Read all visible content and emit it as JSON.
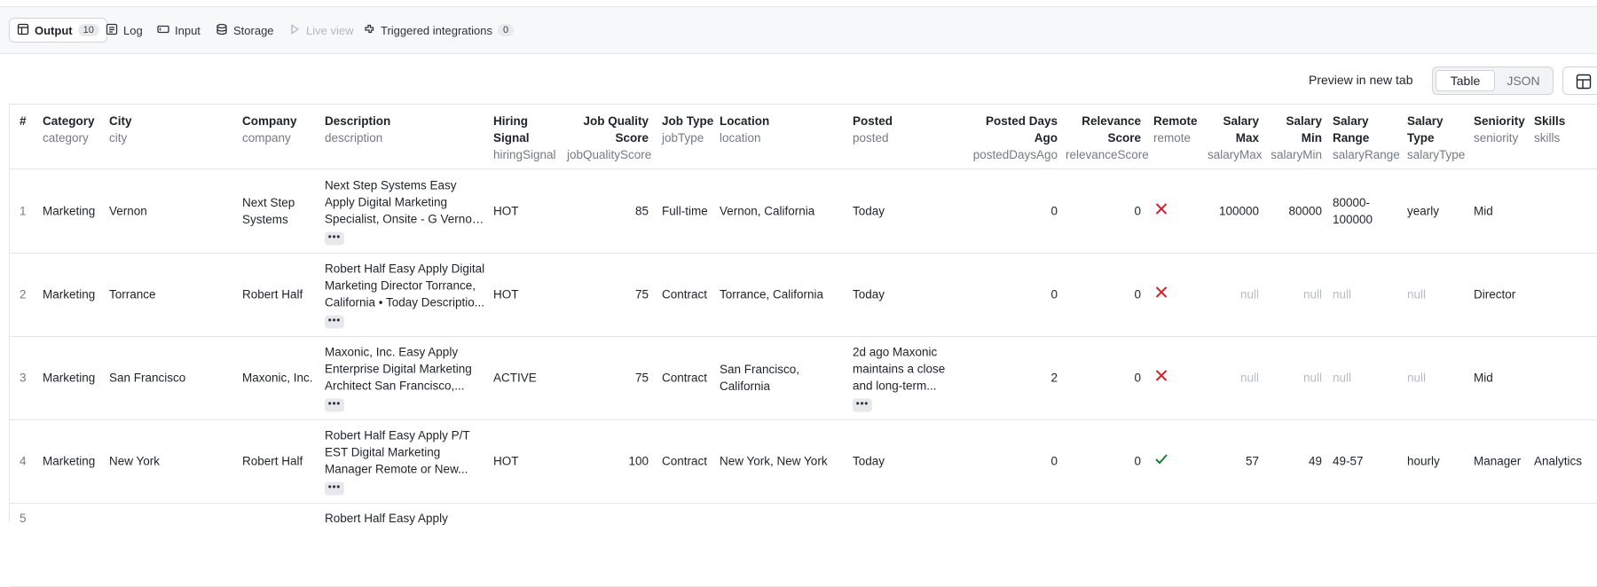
{
  "tabs": [
    {
      "label": "Output",
      "badge": "10",
      "icon": "table-icon",
      "state": "active"
    },
    {
      "label": "Log",
      "icon": "log-icon",
      "state": "normal"
    },
    {
      "label": "Input",
      "icon": "input-icon",
      "state": "normal"
    },
    {
      "label": "Storage",
      "icon": "database-icon",
      "state": "normal"
    },
    {
      "label": "Live view",
      "icon": "play-icon",
      "state": "disabled"
    },
    {
      "label": "Triggered integrations",
      "badge": "0",
      "icon": "integrations-icon",
      "state": "normal"
    }
  ],
  "toolbar": {
    "preview_label": "Preview in new tab",
    "view_table": "Table",
    "view_json": "JSON",
    "active_view": "Table",
    "layout_icon": "layout-icon"
  },
  "colors": {
    "remote_no": "#d1242f",
    "remote_yes": "#1a7f37",
    "null_text": "#b6bbc2"
  },
  "columns": [
    {
      "label": "#",
      "key": ""
    },
    {
      "label": "Category",
      "key": "category"
    },
    {
      "label": "City",
      "key": "city"
    },
    {
      "label": "Company",
      "key": "company"
    },
    {
      "label": "Description",
      "key": "description"
    },
    {
      "label": "Hiring Signal",
      "key": "hiringSignal"
    },
    {
      "label": "Job Quality Score",
      "key": "jobQualityScore"
    },
    {
      "label": "Job Type",
      "key": "jobType"
    },
    {
      "label": "Location",
      "key": "location"
    },
    {
      "label": "Posted",
      "key": "posted"
    },
    {
      "label": "Posted Days Ago",
      "key": "postedDaysAgo"
    },
    {
      "label": "Relevance Score",
      "key": "relevanceScore"
    },
    {
      "label": "Remote",
      "key": "remote"
    },
    {
      "label": "Salary Max",
      "key": "salaryMax"
    },
    {
      "label": "Salary Min",
      "key": "salaryMin"
    },
    {
      "label": "Salary Range",
      "key": "salaryRange"
    },
    {
      "label": "Salary Type",
      "key": "salaryType"
    },
    {
      "label": "Seniority",
      "key": "seniority"
    },
    {
      "label": "Skills",
      "key": "skills"
    }
  ],
  "rows": [
    {
      "num": "1",
      "category": "Marketing",
      "city": "Vernon",
      "company": "Next Step Systems",
      "description": "Next Step Systems Easy Apply Digital Marketing Specialist, Onsite - G Vernon, California...",
      "hiringSignal": "HOT",
      "jobQualityScore": "85",
      "jobType": "Full-time",
      "location": "Vernon, California",
      "posted": "Today",
      "postedDaysAgo": "0",
      "relevanceScore": "0",
      "remote": false,
      "salaryMax": "100000",
      "salaryMin": "80000",
      "salaryRange": "80000-100000",
      "salaryType": "yearly",
      "seniority": "Mid",
      "skills": ""
    },
    {
      "num": "2",
      "category": "Marketing",
      "city": "Torrance",
      "company": "Robert Half",
      "description": "Robert Half Easy Apply Digital Marketing Director Torrance, California • Today Descriptio...",
      "hiringSignal": "HOT",
      "jobQualityScore": "75",
      "jobType": "Contract",
      "location": "Torrance, California",
      "posted": "Today",
      "postedDaysAgo": "0",
      "relevanceScore": "0",
      "remote": false,
      "salaryMax": "null",
      "salaryMin": "null",
      "salaryRange": "null",
      "salaryType": "null",
      "seniority": "Director",
      "skills": ""
    },
    {
      "num": "3",
      "category": "Marketing",
      "city": "San Francisco",
      "company": "Maxonic, Inc.",
      "description": "Maxonic, Inc. Easy Apply Enterprise Digital Marketing Architect San Francisco,...",
      "hiringSignal": "ACTIVE",
      "jobQualityScore": "75",
      "jobType": "Contract",
      "location": "San Francisco, California",
      "posted": "2d ago Maxonic maintains a close and long-term...",
      "postedDaysAgo": "2",
      "relevanceScore": "0",
      "remote": false,
      "salaryMax": "null",
      "salaryMin": "null",
      "salaryRange": "null",
      "salaryType": "null",
      "seniority": "Mid",
      "skills": ""
    },
    {
      "num": "4",
      "category": "Marketing",
      "city": "New York",
      "company": "Robert Half",
      "description": "Robert Half Easy Apply P/T EST Digital Marketing Manager Remote or New...",
      "hiringSignal": "HOT",
      "jobQualityScore": "100",
      "jobType": "Contract",
      "location": "New York, New York",
      "posted": "Today",
      "postedDaysAgo": "0",
      "relevanceScore": "0",
      "remote": true,
      "salaryMax": "57",
      "salaryMin": "49",
      "salaryRange": "49-57",
      "salaryType": "hourly",
      "seniority": "Manager",
      "skills": "Analytics"
    },
    {
      "num": "5",
      "category": "",
      "city": "",
      "company": "",
      "description": "Robert Half Easy Apply",
      "hiringSignal": "",
      "jobQualityScore": "",
      "jobType": "",
      "location": "",
      "posted": "",
      "postedDaysAgo": "",
      "relevanceScore": "",
      "remote": null,
      "salaryMax": "",
      "salaryMin": "",
      "salaryRange": "",
      "salaryType": "",
      "seniority": "",
      "skills": ""
    }
  ]
}
